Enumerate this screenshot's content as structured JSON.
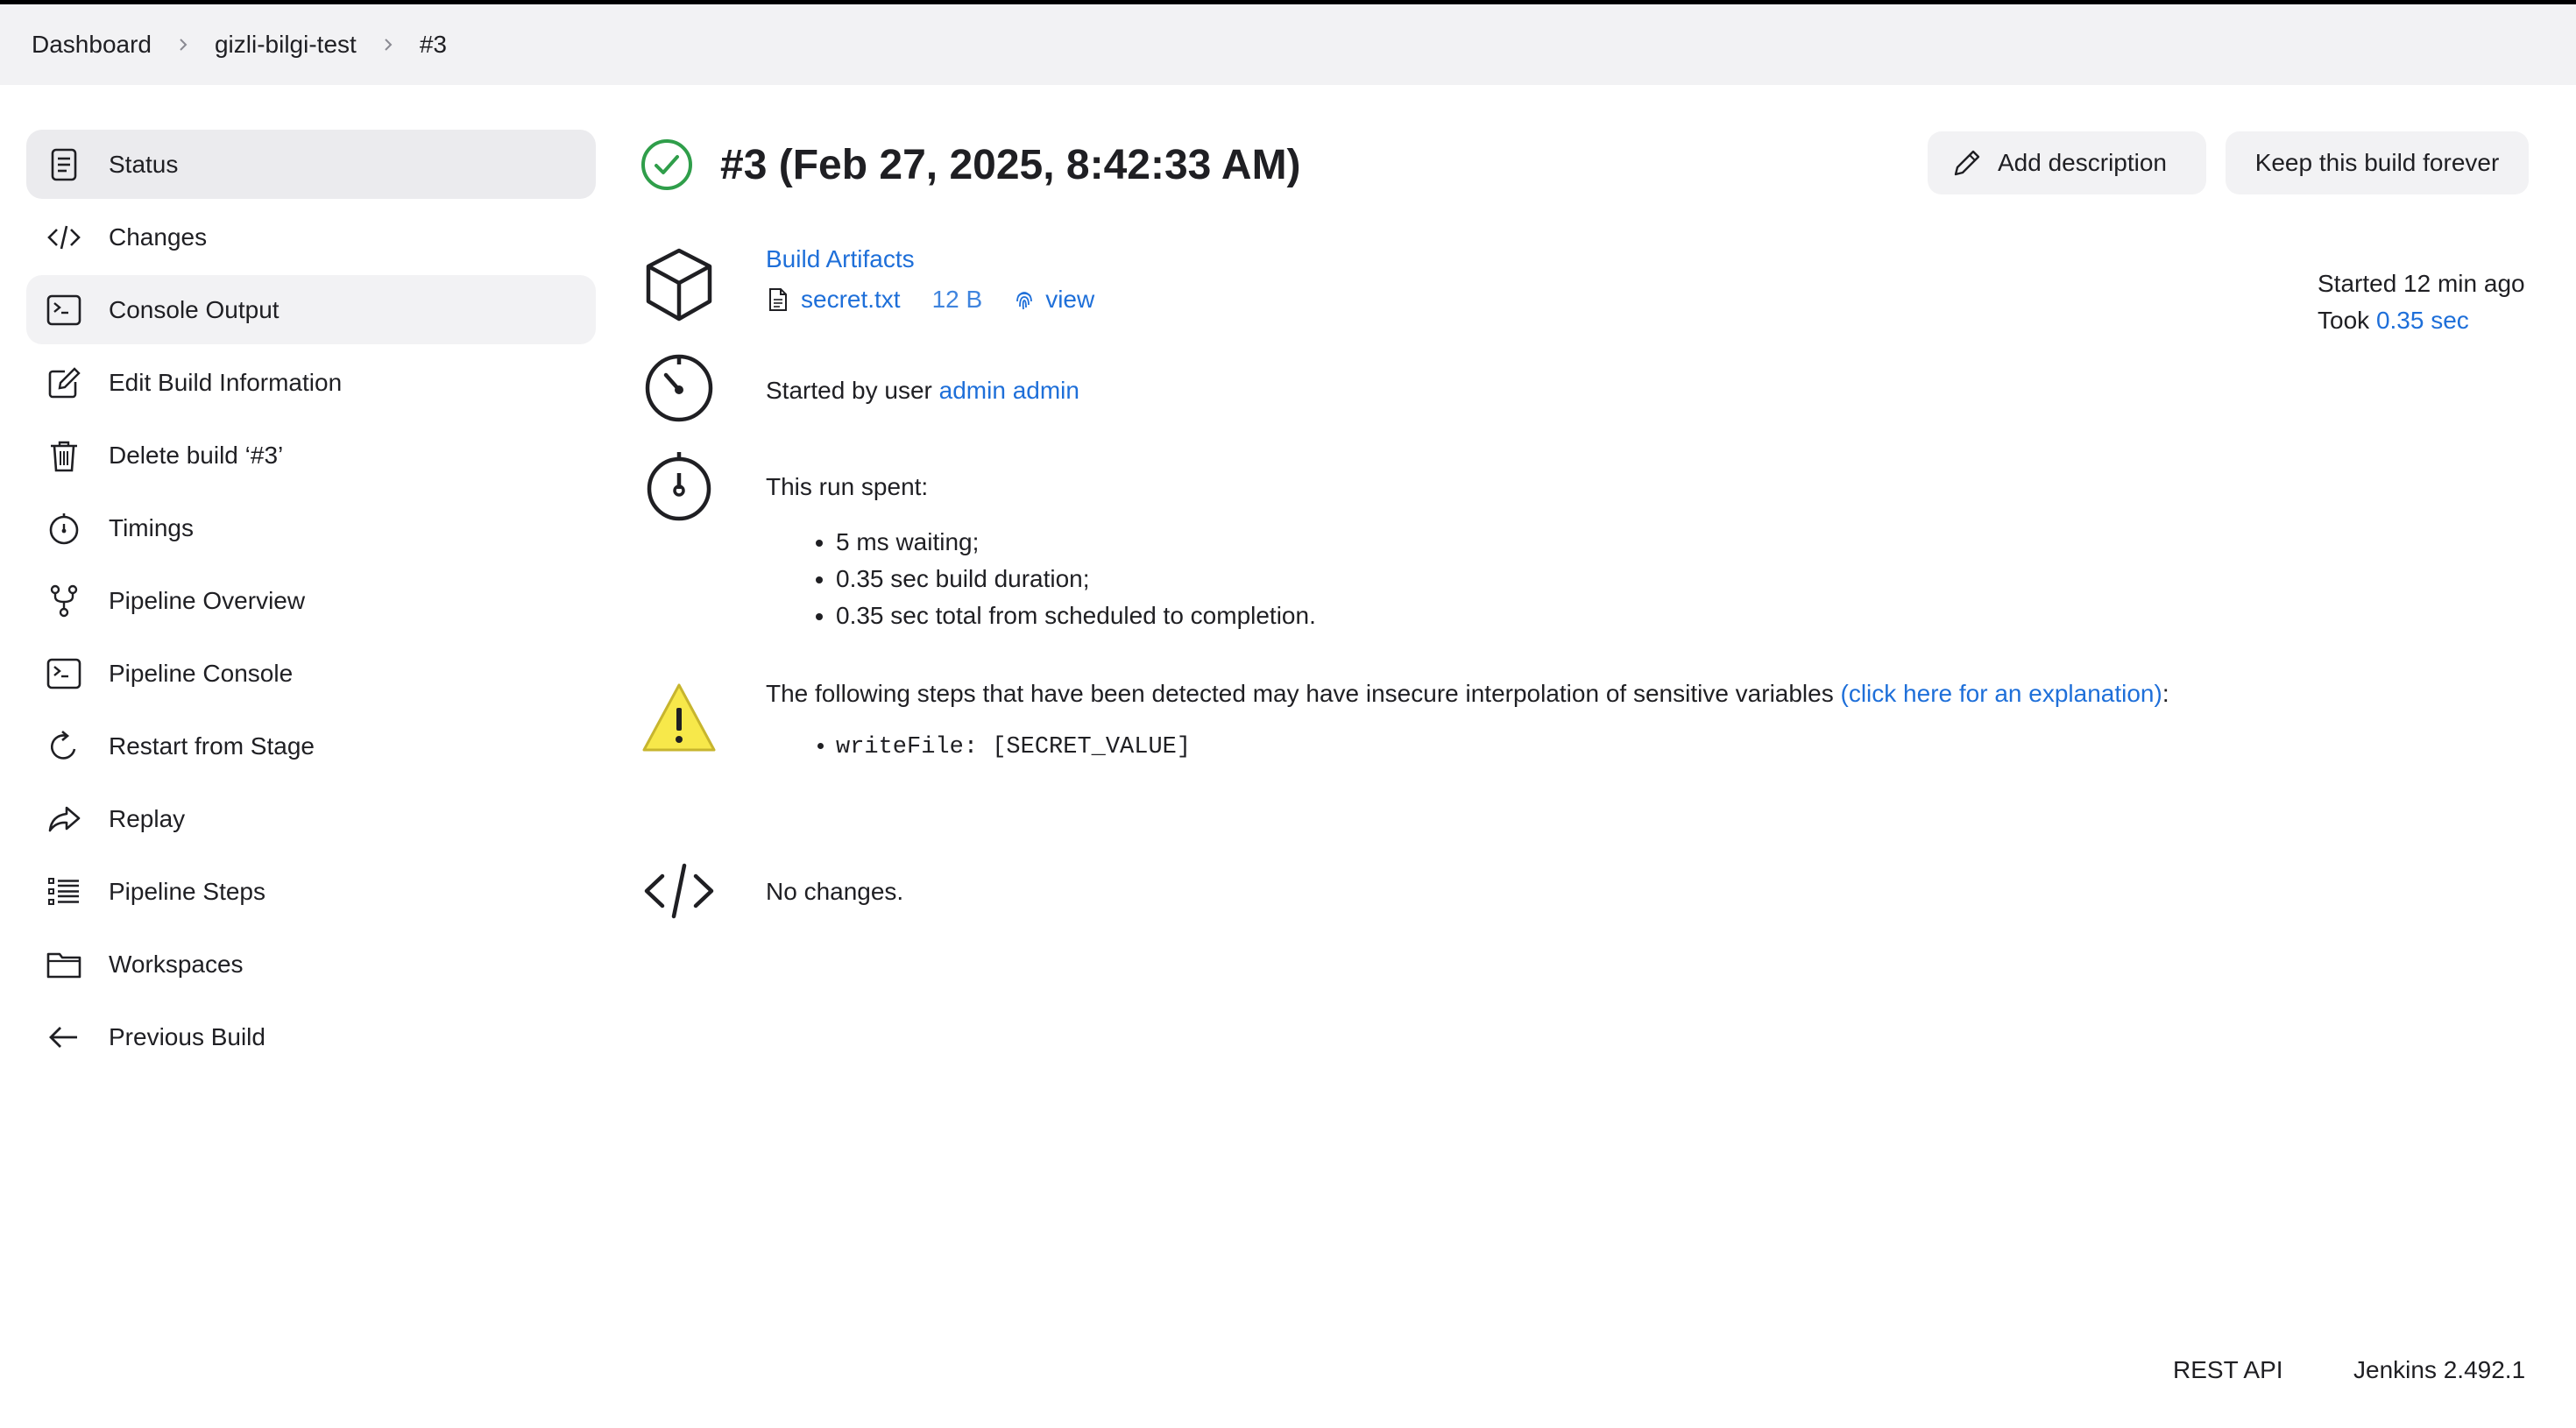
{
  "breadcrumb": [
    "Dashboard",
    "gizli-bilgi-test",
    "#3"
  ],
  "sidebar": {
    "items": [
      {
        "label": "Status",
        "icon": "document-icon"
      },
      {
        "label": "Changes",
        "icon": "code-icon"
      },
      {
        "label": "Console Output",
        "icon": "terminal-icon"
      },
      {
        "label": "Edit Build Information",
        "icon": "edit-icon"
      },
      {
        "label": "Delete build ‘#3’",
        "icon": "trash-icon"
      },
      {
        "label": "Timings",
        "icon": "stopwatch-icon"
      },
      {
        "label": "Pipeline Overview",
        "icon": "branch-icon"
      },
      {
        "label": "Pipeline Console",
        "icon": "terminal-icon"
      },
      {
        "label": "Restart from Stage",
        "icon": "restart-icon"
      },
      {
        "label": "Replay",
        "icon": "replay-icon"
      },
      {
        "label": "Pipeline Steps",
        "icon": "list-icon"
      },
      {
        "label": "Workspaces",
        "icon": "folder-icon"
      },
      {
        "label": "Previous Build",
        "icon": "arrow-left-icon"
      }
    ]
  },
  "build": {
    "title": "#3 (Feb 27, 2025, 8:42:33 AM)",
    "status": "success"
  },
  "buttons": {
    "add_description": "Add description",
    "keep_forever": "Keep this build forever"
  },
  "timing": {
    "started": "Started 12 min ago",
    "took_prefix": "Took ",
    "took_value": "0.35 sec"
  },
  "artifacts": {
    "heading": "Build Artifacts",
    "file_name": "secret.txt",
    "file_size": "12 B",
    "view_label": "view"
  },
  "cause": {
    "prefix": "Started by user ",
    "user": "admin admin"
  },
  "run_spent": {
    "heading": "This run spent:",
    "items": [
      "5 ms waiting;",
      "0.35 sec build duration;",
      "0.35 sec total from scheduled to completion."
    ]
  },
  "warning": {
    "text": "The following steps that have been detected may have insecure interpolation of sensitive variables ",
    "link": "(click here for an explanation)",
    "suffix": ":",
    "step": "writeFile: [SECRET_VALUE]"
  },
  "changes": {
    "text": "No changes."
  },
  "footer": {
    "rest_api": "REST API",
    "version": "Jenkins 2.492.1"
  },
  "colors": {
    "link": "#1e6fd9",
    "success": "#2f9e4a",
    "warning": "#f7e84a"
  }
}
